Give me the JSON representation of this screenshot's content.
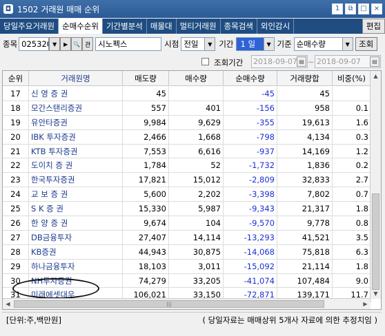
{
  "window": {
    "title": "1502 거래원 매매 순위",
    "buttons": [
      "1",
      "⧉",
      "□",
      "×"
    ]
  },
  "tabs": [
    {
      "label": "당일주요거래원",
      "active": false
    },
    {
      "label": "순매수순위",
      "active": true
    },
    {
      "label": "기간별분석",
      "active": false
    },
    {
      "label": "매물대",
      "active": false
    },
    {
      "label": "멀티거래원",
      "active": false
    },
    {
      "label": "종목검색",
      "active": false
    },
    {
      "label": "외인감시",
      "active": false
    }
  ],
  "edit_label": "편집",
  "toolbar": {
    "stock_label": "종목",
    "stock_code": "025320",
    "stock_name": "시노펙스",
    "time_label": "시점",
    "time_value": "전일",
    "period_label": "기간",
    "period_value": "1 일",
    "criteria_label": "기준",
    "criteria_value": "순매수량",
    "query_button": "조회",
    "query_period_label": "조회기간",
    "date_from": "2018-09-07",
    "date_sep": "~",
    "date_to": "2018-09-07"
  },
  "table": {
    "columns": [
      "순위",
      "거래원명",
      "매도량",
      "매수량",
      "순매수량",
      "거래량합",
      "비중(%)"
    ],
    "rows": [
      [
        "17",
        "신 영  증 권",
        "45",
        "",
        "-45",
        "45",
        ""
      ],
      [
        "18",
        "모간스탠리증권",
        "557",
        "401",
        "-156",
        "958",
        "0.1"
      ],
      [
        "19",
        "유안타증권",
        "9,984",
        "9,629",
        "-355",
        "19,613",
        "1.6"
      ],
      [
        "20",
        "IBK 투자증권",
        "2,466",
        "1,668",
        "-798",
        "4,134",
        "0.3"
      ],
      [
        "21",
        "KTB 투자증권",
        "7,553",
        "6,616",
        "-937",
        "14,169",
        "1.2"
      ],
      [
        "22",
        "도이치 증 권",
        "1,784",
        "52",
        "-1,732",
        "1,836",
        "0.2"
      ],
      [
        "23",
        "한국투자증권",
        "17,821",
        "15,012",
        "-2,809",
        "32,833",
        "2.7"
      ],
      [
        "24",
        "교 보  증 권",
        "5,600",
        "2,202",
        "-3,398",
        "7,802",
        "0.7"
      ],
      [
        "25",
        "S  K   증 권",
        "15,330",
        "5,987",
        "-9,343",
        "21,317",
        "1.8"
      ],
      [
        "26",
        "한 양  증 권",
        "9,674",
        "104",
        "-9,570",
        "9,778",
        "0.8"
      ],
      [
        "27",
        "DB금융투자",
        "27,407",
        "14,114",
        "-13,293",
        "41,521",
        "3.5"
      ],
      [
        "28",
        "KB증권",
        "44,943",
        "30,875",
        "-14,068",
        "75,818",
        "6.3"
      ],
      [
        "29",
        "하나금융투자",
        "18,103",
        "3,011",
        "-15,092",
        "21,114",
        "1.8"
      ],
      [
        "30",
        "NH투자증권",
        "74,279",
        "33,205",
        "-41,074",
        "107,484",
        "9.0"
      ],
      [
        "31",
        "미래에셋대우",
        "106,021",
        "33,150",
        "-72,871",
        "139,171",
        "11.7"
      ]
    ]
  },
  "status": {
    "unit": "[단위:주,백만원]",
    "note": "( 당일자료는 매매상위 5개사 자료에 의한 추정치임 )"
  },
  "colors": {
    "title_bar": "#2b5a96",
    "tab_bar": "#1f4d82",
    "negative_value": "#1a2ed8",
    "broker_name": "#1b3a8c"
  }
}
